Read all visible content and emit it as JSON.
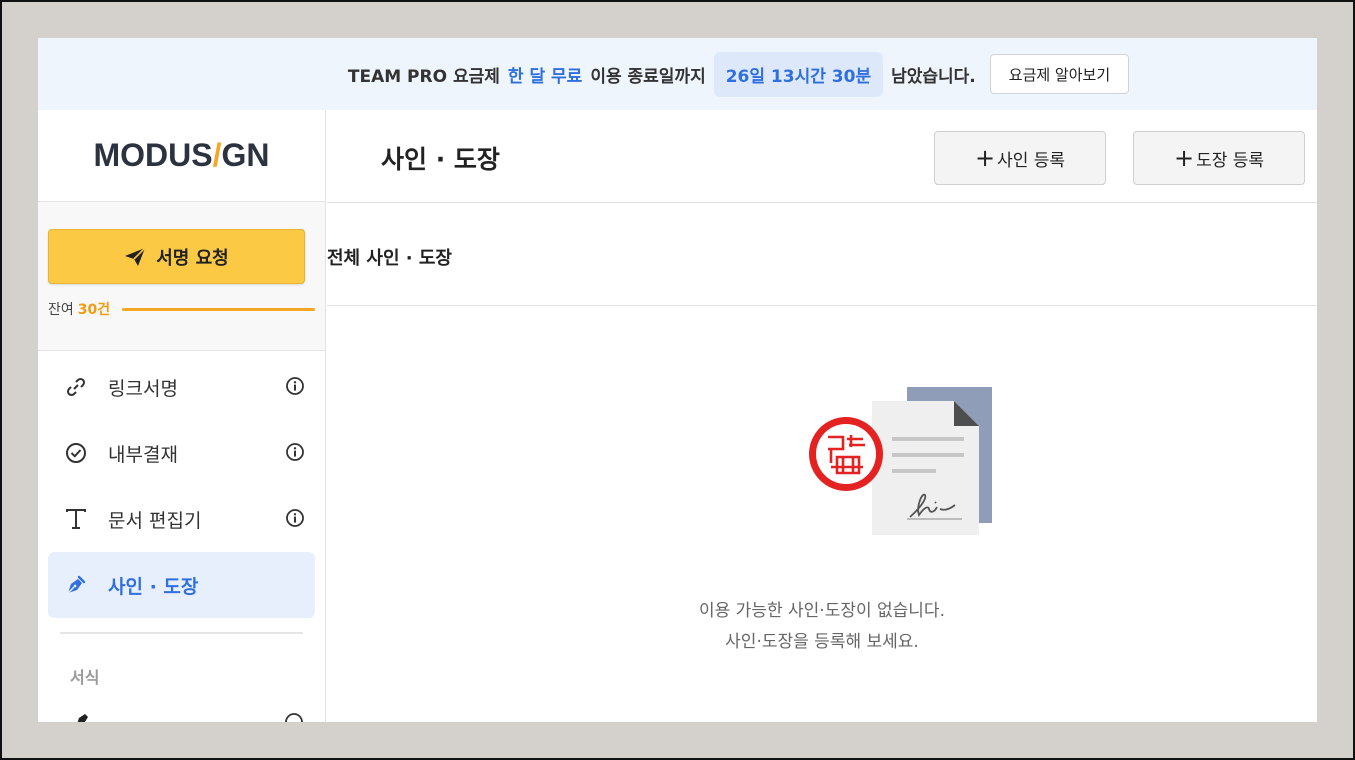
{
  "banner": {
    "text_plan": "TEAM PRO 요금제",
    "text_free": "한 달 무료",
    "text_until": "이용 종료일까지",
    "countdown": "26일 13시간 30분",
    "text_left": "남았습니다.",
    "learn_button": "요금제 알아보기"
  },
  "sidebar": {
    "logo_left": "MODUS",
    "logo_slash": "/",
    "logo_right": "GN",
    "request_button": "서명 요청",
    "remain_label": "잔여",
    "remain_count": "30건",
    "items": [
      {
        "label": "링크서명",
        "icon": "link-icon"
      },
      {
        "label": "내부결재",
        "icon": "check-circle-icon"
      },
      {
        "label": "문서 편집기",
        "icon": "text-t-icon"
      },
      {
        "label": "사인 · 도장",
        "icon": "pen-nib-icon",
        "active": true
      }
    ],
    "section_label": "서식",
    "accent_color": "#2f6fe0",
    "request_color": "#fbc943"
  },
  "main": {
    "title": "사인 · 도장",
    "add_sign_button": "사인 등록",
    "add_stamp_button": "도장 등록",
    "filter_title": "전체 사인 · 도장",
    "empty_line1": "이용 가능한 사인·도장이 없습니다.",
    "empty_line2": "사인·도장을 등록해 보세요."
  }
}
